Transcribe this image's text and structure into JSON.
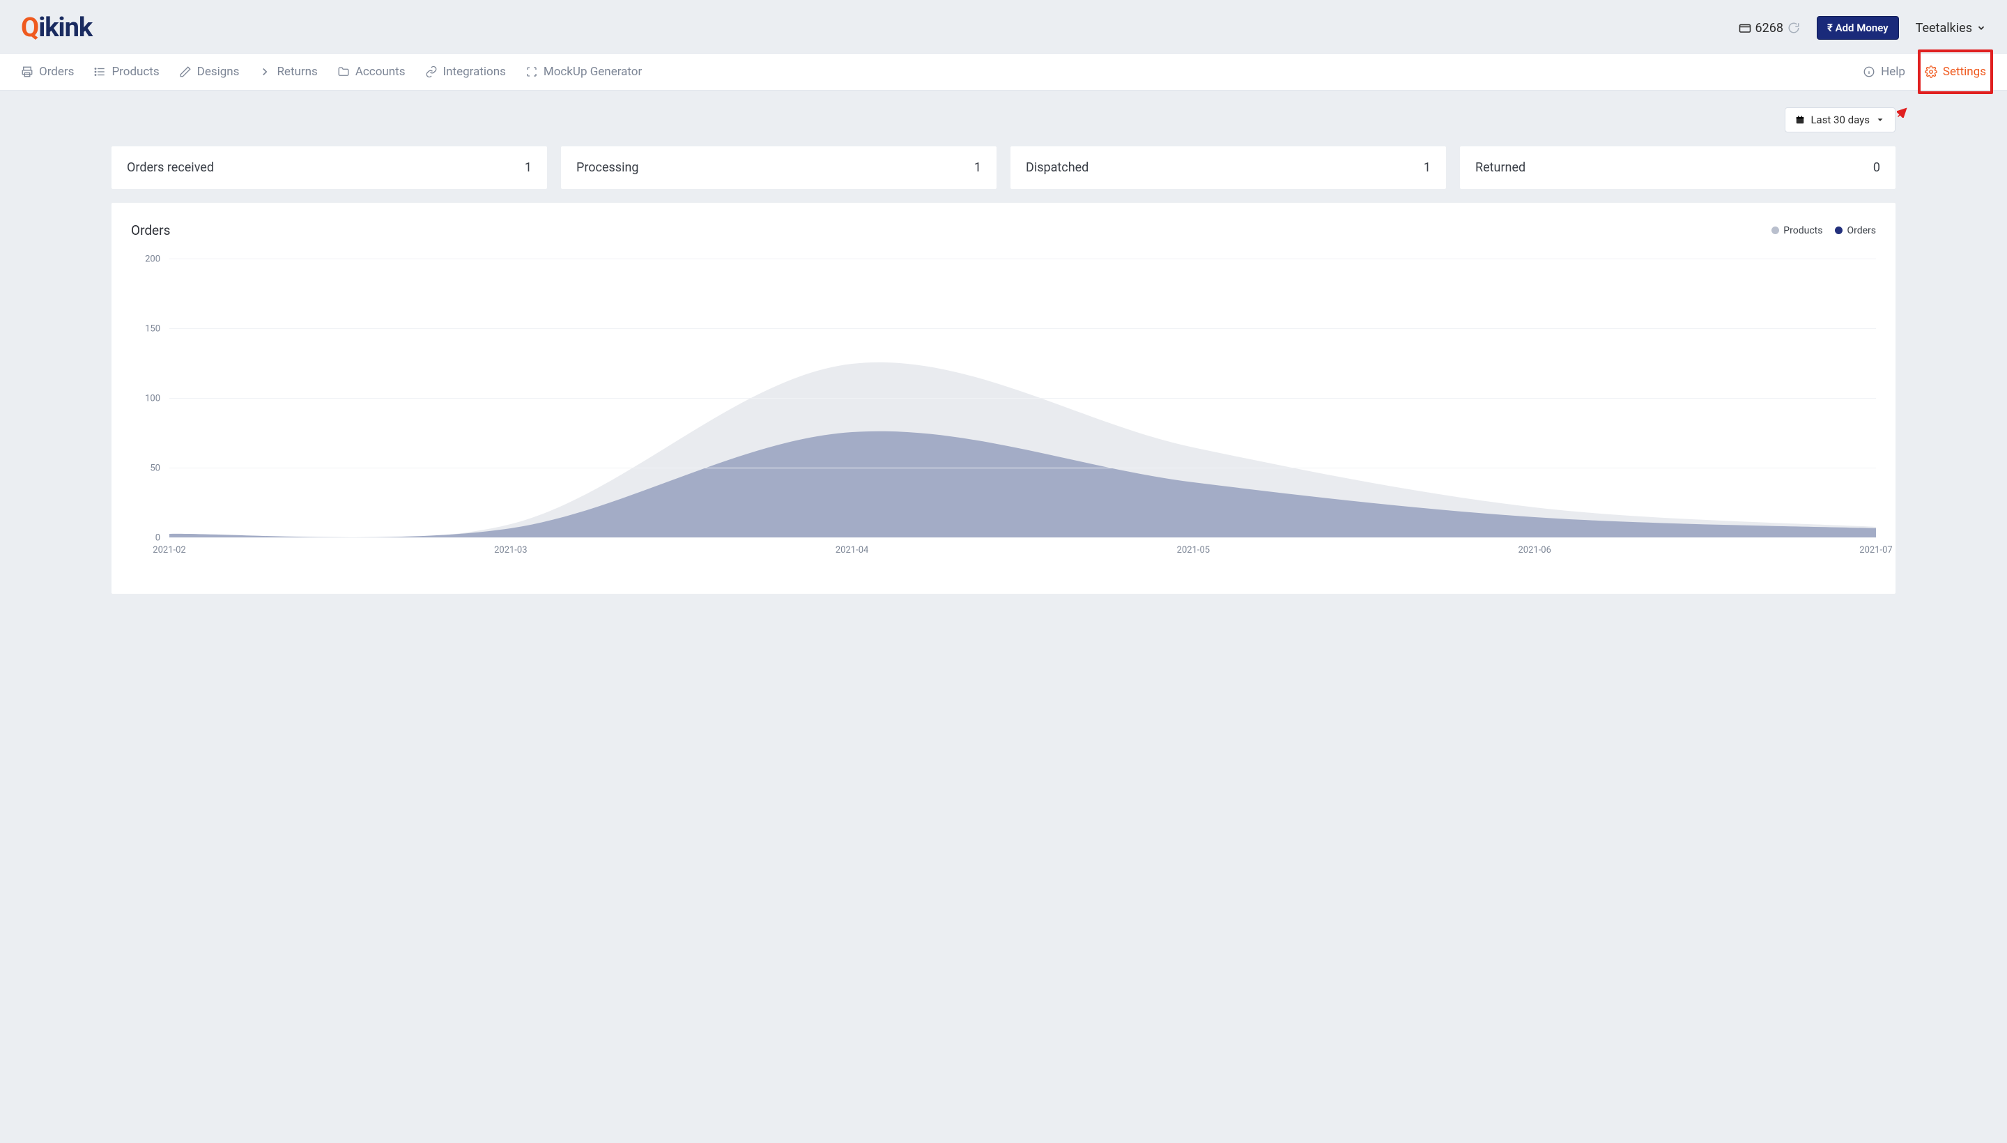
{
  "logo": {
    "part1": "Q",
    "part2": "ikink"
  },
  "header": {
    "wallet_balance": "6268",
    "add_money_label": "Add Money",
    "rupee_symbol": "₹",
    "user_name": "Teetalkies"
  },
  "nav": {
    "items": [
      {
        "label": "Orders",
        "icon": "printer"
      },
      {
        "label": "Products",
        "icon": "list"
      },
      {
        "label": "Designs",
        "icon": "pencil"
      },
      {
        "label": "Returns",
        "icon": "chevron-right"
      },
      {
        "label": "Accounts",
        "icon": "folder"
      },
      {
        "label": "Integrations",
        "icon": "link"
      },
      {
        "label": "MockUp Generator",
        "icon": "frame"
      }
    ],
    "help_label": "Help",
    "settings_label": "Settings"
  },
  "filter": {
    "range_label": "Last 30 days"
  },
  "stats": [
    {
      "label": "Orders received",
      "value": "1"
    },
    {
      "label": "Processing",
      "value": "1"
    },
    {
      "label": "Dispatched",
      "value": "1"
    },
    {
      "label": "Returned",
      "value": "0"
    }
  ],
  "chart": {
    "title": "Orders",
    "legend": [
      {
        "name": "Products",
        "color": "#b9bfcd"
      },
      {
        "name": "Orders",
        "color": "#23307c"
      }
    ]
  },
  "chart_data": {
    "type": "area",
    "x": [
      "2021-02",
      "2021-03",
      "2021-04",
      "2021-05",
      "2021-06",
      "2021-07"
    ],
    "series": [
      {
        "name": "Products",
        "values": [
          3,
          10,
          125,
          65,
          22,
          8
        ]
      },
      {
        "name": "Orders",
        "values": [
          3,
          7,
          76,
          40,
          15,
          7
        ]
      }
    ],
    "ylabel": "",
    "xlabel": "",
    "ylim": [
      0,
      200
    ],
    "y_ticks": [
      0,
      50,
      100,
      150,
      200
    ]
  }
}
